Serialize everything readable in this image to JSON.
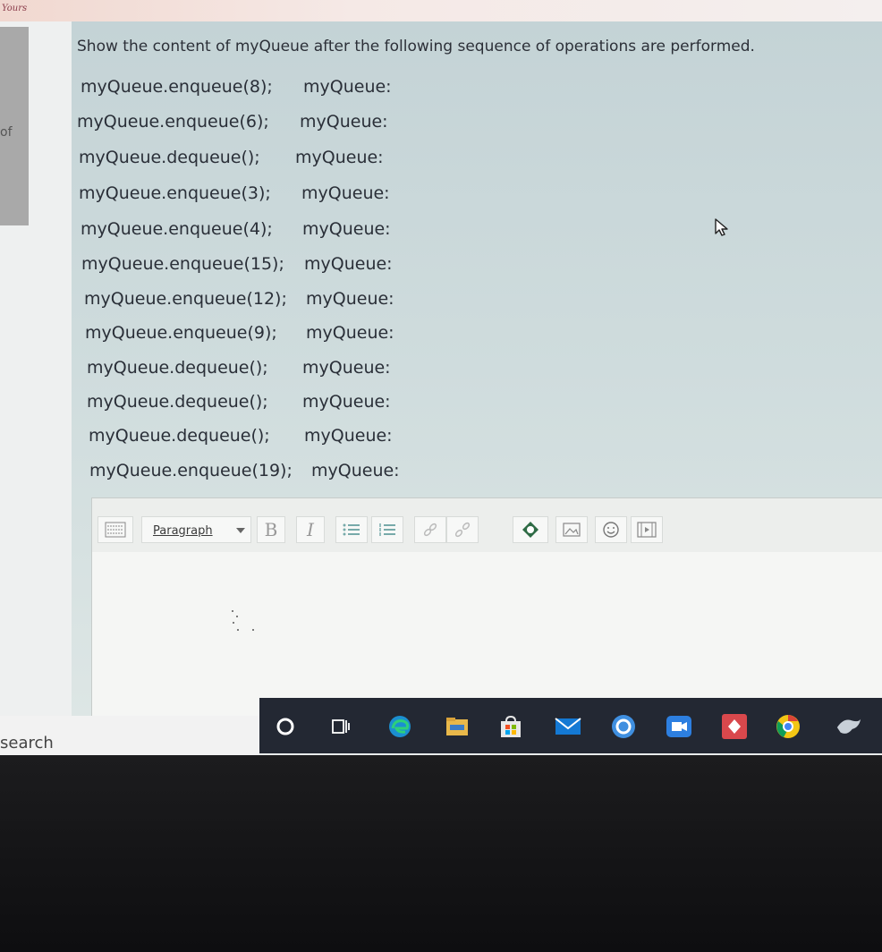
{
  "browser": {
    "top_label": "Yours"
  },
  "left_pane": {
    "fragment": "of"
  },
  "question": {
    "prompt": "Show the content of myQueue after the following sequence of operations are performed.",
    "operations": [
      {
        "call": "myQueue.enqueue(8);",
        "result_label": "myQueue:"
      },
      {
        "call": "myQueue.enqueue(6);",
        "result_label": "myQueue:"
      },
      {
        "call": "myQueue.dequeue();",
        "result_label": "myQueue:"
      },
      {
        "call": "myQueue.enqueue(3);",
        "result_label": "myQueue:"
      },
      {
        "call": "myQueue.enqueue(4);",
        "result_label": "myQueue:"
      },
      {
        "call": "myQueue.enqueue(15);",
        "result_label": "myQueue:"
      },
      {
        "call": "myQueue.enqueue(12);",
        "result_label": "myQueue:"
      },
      {
        "call": "myQueue.enqueue(9);",
        "result_label": "myQueue:"
      },
      {
        "call": "myQueue.dequeue();",
        "result_label": "myQueue:"
      },
      {
        "call": "myQueue.dequeue();",
        "result_label": "myQueue:"
      },
      {
        "call": "myQueue.dequeue();",
        "result_label": "myQueue:"
      },
      {
        "call": "myQueue.enqueue(19);",
        "result_label": "myQueue:"
      }
    ]
  },
  "editor": {
    "toolbar": {
      "toggle_icon": "toolbar-toggle-icon",
      "format_select": "Paragraph",
      "bold": "B",
      "italic": "I",
      "bullet_list_icon": "bullet-list-icon",
      "numbered_list_icon": "numbered-list-icon",
      "link_icon": "link-icon",
      "unlink_icon": "unlink-icon",
      "h5p_icon": "h5p-icon",
      "image_icon": "image-icon",
      "emoji_icon": "emoji-icon",
      "media_icon": "media-icon"
    },
    "content": ""
  },
  "taskbar": {
    "search_text": "search",
    "icons": [
      "cortana-icon",
      "task-view-icon",
      "edge-icon",
      "file-explorer-icon",
      "store-icon",
      "mail-icon",
      "app-icon",
      "video-icon",
      "photos-icon",
      "chrome-icon",
      "app-bird-icon"
    ]
  },
  "colors": {
    "question_bg": "#cbd9db",
    "text": "#2a2f38",
    "taskbar": "#232833"
  }
}
